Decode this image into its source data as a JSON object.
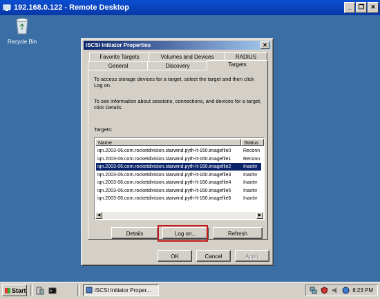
{
  "remote_desktop": {
    "title": "192.168.0.122 - Remote Desktop",
    "minimize": "_",
    "restore": "❐",
    "close": "✕"
  },
  "desktop": {
    "recycle_bin_label": "Recycle Bin"
  },
  "dialog": {
    "title": "iSCSI Initiator Properties",
    "close": "✕",
    "tabs_row1": [
      "Favorite Targets",
      "Volumes and Devices",
      "RADIUS"
    ],
    "tabs_row2": [
      "General",
      "Discovery",
      "Targets"
    ],
    "active_tab": "Targets",
    "instruction1": "To access storage devices for a target, select the target and then click Log on.",
    "instruction2": "To see information about sessions, connections, and devices for a target, click Details.",
    "targets_label": "Targets:",
    "columns": [
      "Name",
      "Status"
    ],
    "rows": [
      {
        "name": "iqn.2003-06.com.rocketdivision.starwind.pyth-lt-160.imagefile0",
        "status": "Reconn"
      },
      {
        "name": "iqn.2003-06.com.rocketdivision.starwind.pyth-lt-160.imagefile1",
        "status": "Reconn"
      },
      {
        "name": "iqn.2003-06.com.rocketdivision.starwind.pyth-lt-160.imagefile2",
        "status": "Inactiv"
      },
      {
        "name": "iqn.2003-06.com.rocketdivision.starwind.pyth-lt-160.imagefile3",
        "status": "Inactiv"
      },
      {
        "name": "iqn.2003-06.com.rocketdivision.starwind.pyth-lt-160.imagefile4",
        "status": "Inactiv"
      },
      {
        "name": "iqn.2003-06.com.rocketdivision.starwind.pyth-lt-160.imagefile5",
        "status": "Inactiv"
      },
      {
        "name": "iqn.2003-06.com.rocketdivision.starwind.pyth-lt-160.imagefile6",
        "status": "Inactiv"
      }
    ],
    "selected_row": 2,
    "buttons": {
      "details": "Details",
      "logon": "Log on...",
      "refresh": "Refresh",
      "ok": "OK",
      "cancel": "Cancel",
      "apply": "Apply"
    }
  },
  "taskbar": {
    "start": "Start",
    "task_item": "iSCSI Initiator Proper...",
    "clock": "8:23 PM"
  },
  "colors": {
    "desktop": "#3a6ea5",
    "highlight_box": "#c41a1a",
    "selection": "#0a246a"
  }
}
